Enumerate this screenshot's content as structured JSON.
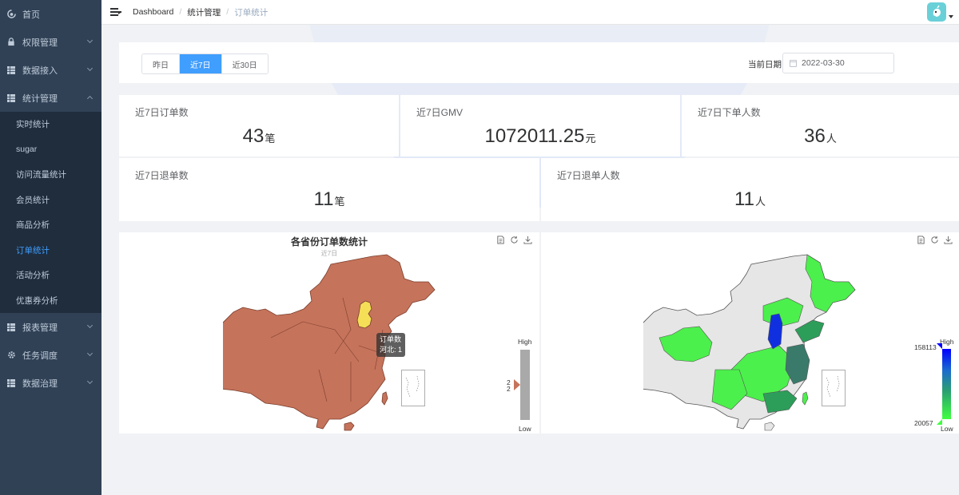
{
  "sidebar": {
    "items": [
      {
        "label": "首页",
        "icon": "dashboard-icon"
      },
      {
        "label": "权限管理",
        "icon": "lock-icon"
      },
      {
        "label": "数据接入",
        "icon": "grid-icon"
      },
      {
        "label": "统计管理",
        "icon": "grid-icon"
      }
    ],
    "submenu": [
      {
        "label": "实时统计"
      },
      {
        "label": "sugar"
      },
      {
        "label": "访问流量统计"
      },
      {
        "label": "会员统计"
      },
      {
        "label": "商品分析"
      },
      {
        "label": "订单统计",
        "active": true
      },
      {
        "label": "活动分析"
      },
      {
        "label": "优惠券分析"
      }
    ],
    "bottom_items": [
      {
        "label": "报表管理",
        "icon": "grid-icon"
      },
      {
        "label": "任务调度",
        "icon": "gear-icon"
      },
      {
        "label": "数据治理",
        "icon": "grid-icon"
      }
    ]
  },
  "header": {
    "breadcrumb": [
      "Dashboard",
      "统计管理",
      "订单统计"
    ],
    "separator": "/"
  },
  "filter": {
    "tabs": [
      "昨日",
      "近7日",
      "近30日"
    ],
    "active_tab": 1,
    "date_label": "当前日期",
    "date_value": "2022-03-30"
  },
  "stats": {
    "row1": [
      {
        "label": "近7日订单数",
        "value": "43",
        "unit": "笔"
      },
      {
        "label": "近7日GMV",
        "value": "1072011.25",
        "unit": "元"
      },
      {
        "label": "近7日下单人数",
        "value": "36",
        "unit": "人"
      }
    ],
    "row2": [
      {
        "label": "近7日退单数",
        "value": "11",
        "unit": "笔"
      },
      {
        "label": "近7日退单人数",
        "value": "11",
        "unit": "人"
      }
    ]
  },
  "charts": {
    "left": {
      "title": "各省份订单数统计",
      "subtitle": "近7日",
      "visualmap": {
        "high": "High",
        "low": "Low",
        "marker_value": "2",
        "fill_color": "#c6735b",
        "bar_color": "#a9a9a9"
      },
      "tooltip": {
        "title": "订单数",
        "line": "河北: 1"
      },
      "map_color": "#c6735b",
      "highlight_color": "#f4df57"
    },
    "right": {
      "visualmap": {
        "high": "High",
        "low": "Low",
        "max": "158113",
        "min": "20057",
        "high_color": "#0000ff",
        "low_color": "#40ff40"
      },
      "map_colors": [
        "#e6e6e6",
        "#4cf04c",
        "#2d9d5a",
        "#3a7a6a",
        "#1030e0"
      ]
    }
  },
  "chart_data": [
    {
      "type": "map",
      "title": "各省份订单数统计",
      "subtitle": "近7日",
      "series": [
        {
          "name": "订单数",
          "data": [
            {
              "name": "河北",
              "value": 1
            }
          ]
        }
      ],
      "visualmap": {
        "min_label": "Low",
        "max_label": "High",
        "marker": 2
      }
    },
    {
      "type": "map",
      "visualmap": {
        "min": 20057,
        "max": 158113,
        "min_label": "Low",
        "max_label": "High"
      }
    }
  ]
}
